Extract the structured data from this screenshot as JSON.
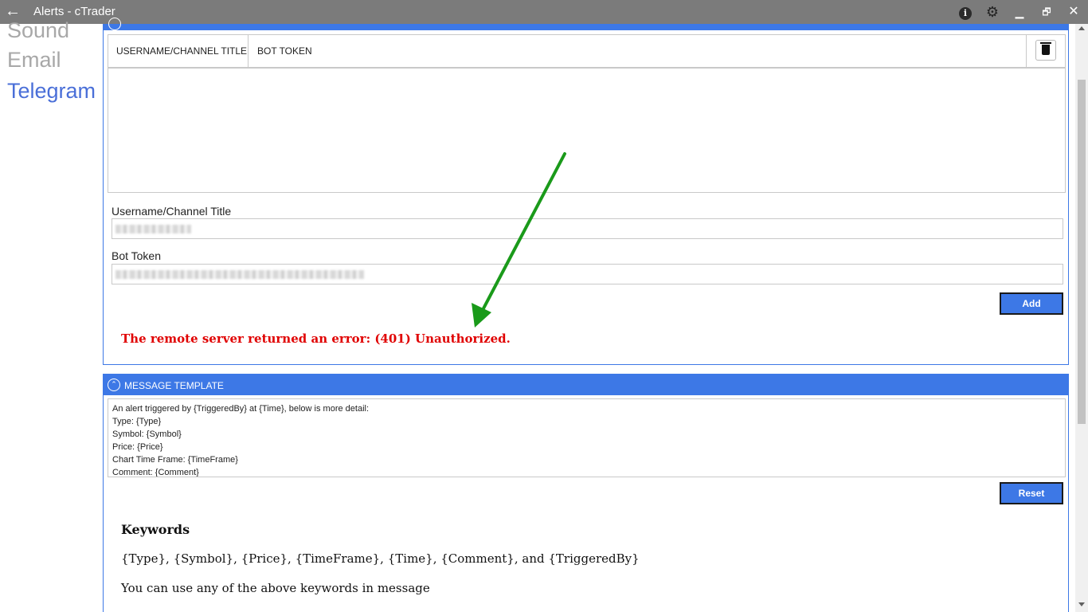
{
  "window": {
    "title": "Alerts - cTrader",
    "back_icon": "arrow-left-icon",
    "info_icon": "info-icon",
    "info_glyph": "i",
    "settings_icon": "gear-icon",
    "minimize_glyph": "▁",
    "maximize_glyph": "🗗",
    "close_glyph": "✕",
    "colors": {
      "titlebar": "#7b7b7b"
    }
  },
  "sidebar": {
    "items": [
      {
        "label": "Sound",
        "active": false
      },
      {
        "label": "Email",
        "active": false
      },
      {
        "label": "Telegram",
        "active": true
      }
    ],
    "colors": {
      "active": "#4a6fd8",
      "inactive": "#a8a8a8"
    }
  },
  "conversations": {
    "columns": [
      "USERNAME/CHANNEL TITLE",
      "BOT TOKEN"
    ],
    "rows": [],
    "delete_icon": "trash-icon",
    "username_label": "Username/Channel Title",
    "bot_token_label": "Bot Token",
    "add_label": "Add",
    "error_message": "The remote server returned an error: (401) Unauthorized."
  },
  "message_template": {
    "header": "MESSAGE TEMPLATE",
    "lines": [
      "An alert triggered by {TriggeredBy} at {Time}, below is more detail:",
      "Type: {Type}",
      "Symbol: {Symbol}",
      "Price: {Price}",
      "Chart Time Frame: {TimeFrame}",
      "Comment: {Comment}"
    ],
    "reset_label": "Reset"
  },
  "keywords": {
    "title": "Keywords",
    "list": "{Type}, {Symbol}, {Price}, {TimeFrame}, {Time}, {Comment}, and {TriggeredBy}",
    "note": "You can use any of the above keywords in message"
  },
  "colors": {
    "accent": "#3d78e6",
    "error": "#e00000",
    "annotation_arrow": "#1a9a1a"
  }
}
